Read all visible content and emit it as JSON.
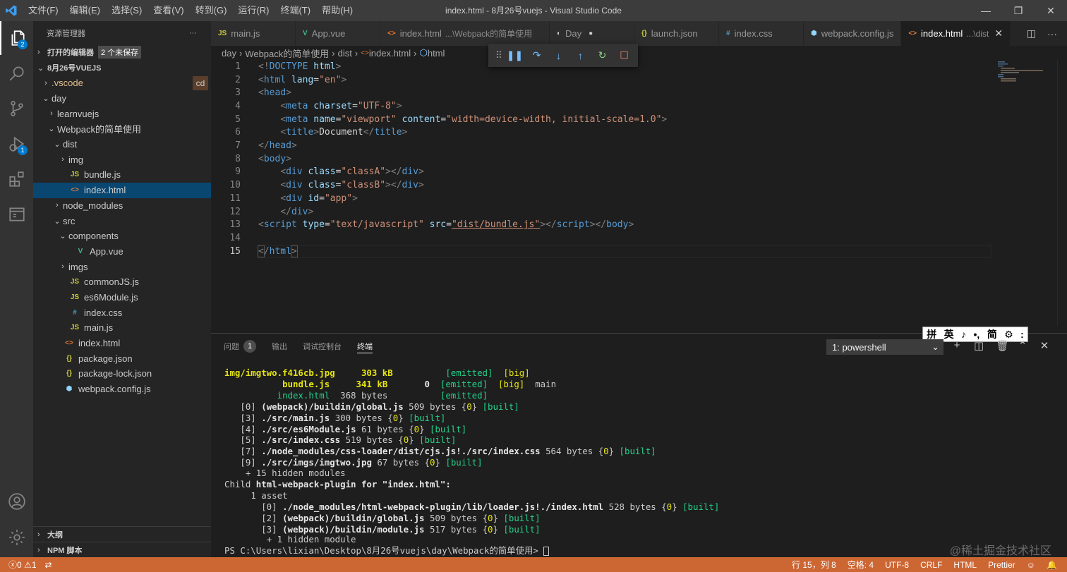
{
  "titlebar": {
    "title": "index.html - 8月26号vuejs - Visual Studio Code",
    "menu": [
      "文件(F)",
      "编辑(E)",
      "选择(S)",
      "查看(V)",
      "转到(G)",
      "运行(R)",
      "终端(T)",
      "帮助(H)"
    ]
  },
  "activity": {
    "explorer_badge": "2",
    "debug_badge": "1"
  },
  "sidebar": {
    "header": "资源管理器",
    "more": "···",
    "open_editors": "打开的编辑器",
    "unsaved": "2 个未保存",
    "workspace": "8月26号VUEJS",
    "cd_badge": "cd",
    "tree": [
      {
        "label": ".vscode",
        "depth": 1,
        "chev": "›",
        "icon": "",
        "dim": true
      },
      {
        "label": "day",
        "depth": 1,
        "chev": "⌄",
        "icon": ""
      },
      {
        "label": "learnvuejs",
        "depth": 2,
        "chev": "›",
        "icon": ""
      },
      {
        "label": "Webpack的简单使用",
        "depth": 2,
        "chev": "⌄",
        "icon": ""
      },
      {
        "label": "dist",
        "depth": 3,
        "chev": "⌄",
        "icon": ""
      },
      {
        "label": "img",
        "depth": 4,
        "chev": "›",
        "icon": ""
      },
      {
        "label": "bundle.js",
        "depth": 4,
        "chev": "",
        "icon": "JS",
        "type": "js"
      },
      {
        "label": "index.html",
        "depth": 4,
        "chev": "",
        "icon": "<>",
        "type": "html",
        "selected": true
      },
      {
        "label": "node_modules",
        "depth": 3,
        "chev": "›",
        "icon": ""
      },
      {
        "label": "src",
        "depth": 3,
        "chev": "⌄",
        "icon": ""
      },
      {
        "label": "components",
        "depth": 4,
        "chev": "⌄",
        "icon": ""
      },
      {
        "label": "App.vue",
        "depth": 5,
        "chev": "",
        "icon": "V",
        "type": "vue"
      },
      {
        "label": "imgs",
        "depth": 4,
        "chev": "›",
        "icon": ""
      },
      {
        "label": "commonJS.js",
        "depth": 4,
        "chev": "",
        "icon": "JS",
        "type": "js"
      },
      {
        "label": "es6Module.js",
        "depth": 4,
        "chev": "",
        "icon": "JS",
        "type": "js"
      },
      {
        "label": "index.css",
        "depth": 4,
        "chev": "",
        "icon": "#",
        "type": "css"
      },
      {
        "label": "main.js",
        "depth": 4,
        "chev": "",
        "icon": "JS",
        "type": "js"
      },
      {
        "label": "index.html",
        "depth": 3,
        "chev": "",
        "icon": "<>",
        "type": "html"
      },
      {
        "label": "package.json",
        "depth": 3,
        "chev": "",
        "icon": "{}",
        "type": "json"
      },
      {
        "label": "package-lock.json",
        "depth": 3,
        "chev": "",
        "icon": "{}",
        "type": "json"
      },
      {
        "label": "webpack.config.js",
        "depth": 3,
        "chev": "",
        "icon": "⬢",
        "type": "wp"
      }
    ],
    "outline": "大纲",
    "npm": "NPM 脚本"
  },
  "tabs": [
    {
      "icon": "JS",
      "type": "js",
      "label": "main.js"
    },
    {
      "icon": "V",
      "type": "vue",
      "label": "App.vue"
    },
    {
      "icon": "<>",
      "type": "html",
      "label": "index.html",
      "desc": "...\\Webpack的简单使用"
    },
    {
      "icon": "◐",
      "type": "plain",
      "label": "Day",
      "dot": true
    },
    {
      "icon": "{}",
      "type": "json",
      "label": "launch.json"
    },
    {
      "icon": "#",
      "type": "css",
      "label": "index.css"
    },
    {
      "icon": "⬢",
      "type": "wp",
      "label": "webpack.config.js"
    },
    {
      "icon": "<>",
      "type": "html",
      "label": "index.html",
      "desc": "...\\dist",
      "active": true,
      "close": true
    }
  ],
  "breadcrumb": [
    "day",
    "Webpack的简单使用",
    "dist",
    "index.html",
    "html"
  ],
  "editor": {
    "line_numbers": [
      "1",
      "2",
      "3",
      "4",
      "5",
      "6",
      "7",
      "8",
      "9",
      "10",
      "11",
      "12",
      "13",
      "14",
      "15"
    ]
  },
  "panel": {
    "tabs": [
      "问题",
      "输出",
      "调试控制台",
      "终端"
    ],
    "problem_count": "1",
    "terminal_select": "1: powershell",
    "ime": [
      "拼",
      "英",
      "♪",
      "•,",
      "简",
      "⚙",
      ":"
    ]
  },
  "terminal": {
    "l1_file": "img/imgtwo.f416cb.jpg",
    "l1_size": "303 kB",
    "l1_status": "[emitted]",
    "l1_big": "[big]",
    "l2_file": "bundle.js",
    "l2_size": "341 kB",
    "l2_chunk": "0",
    "l2_status": "[emitted]",
    "l2_big": "[big]",
    "l2_name": "main",
    "l3_file": "index.html",
    "l3_size": "368 bytes",
    "l3_status": "[emitted]",
    "modules": [
      {
        "id": "[0]",
        "path": "(webpack)/buildin/global.js",
        "size": "509 bytes"
      },
      {
        "id": "[3]",
        "path": "./src/main.js",
        "size": "300 bytes"
      },
      {
        "id": "[4]",
        "path": "./src/es6Module.js",
        "size": "61 bytes"
      },
      {
        "id": "[5]",
        "path": "./src/index.css",
        "size": "519 bytes"
      },
      {
        "id": "[7]",
        "path": "./node_modules/css-loader/dist/cjs.js!./src/index.css",
        "size": "564 bytes"
      },
      {
        "id": "[9]",
        "path": "./src/imgs/imgtwo.jpg",
        "size": "67 bytes"
      }
    ],
    "chunk_zero": "0",
    "built": "[built]",
    "hidden1": "+ 15 hidden modules",
    "child_prefix": "Child ",
    "child_name": "html-webpack-plugin for \"index.html\":",
    "asset": "1 asset",
    "child_modules": [
      {
        "id": "[0]",
        "path": "./node_modules/html-webpack-plugin/lib/loader.js!./index.html",
        "size": "528 bytes"
      },
      {
        "id": "[2]",
        "path": "(webpack)/buildin/global.js",
        "size": "509 bytes"
      },
      {
        "id": "[3]",
        "path": "(webpack)/buildin/module.js",
        "size": "517 bytes"
      }
    ],
    "hidden2": "+ 1 hidden module",
    "prompt": "PS C:\\Users\\lixian\\Desktop\\8月26号vuejs\\day\\Webpack的简单使用> "
  },
  "statusbar": {
    "errors": "0",
    "warnings": "1",
    "position": "行 15，列 8",
    "spaces": "空格: 4",
    "encoding": "UTF-8",
    "eol": "CRLF",
    "language": "HTML",
    "formatter": "Prettier"
  },
  "watermark": "@稀土掘金技术社区",
  "colors": {
    "statusbar": "#cc6633",
    "accent": "#007acc",
    "selection": "#094771"
  }
}
